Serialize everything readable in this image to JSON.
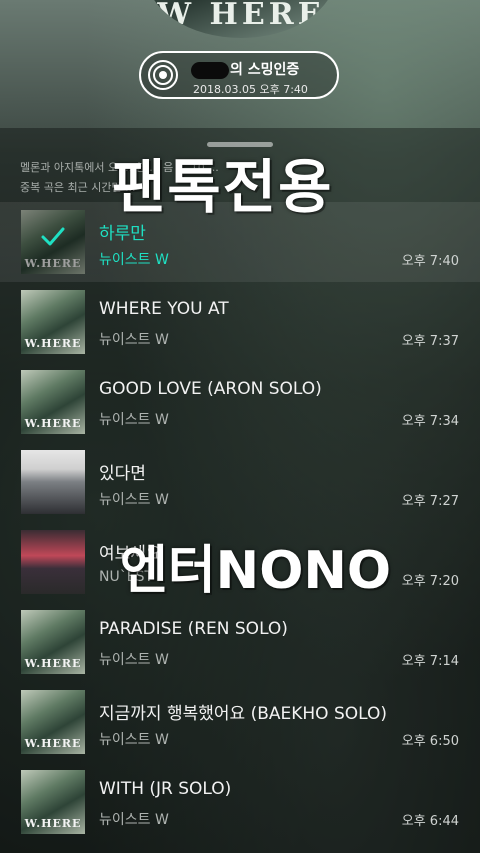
{
  "header": {
    "album_text": "W HERE",
    "cert_title_suffix": "의 스밍인증",
    "cert_date": "2018.03.05 오후 7:40"
  },
  "notice": {
    "line1": "멜론과 아지톡에서 오 ... 한 ... 음 ... 10 ...",
    "line2": "중복 곡은 최근 시간만 ..."
  },
  "watermarks": {
    "top": "팬톡전용",
    "middle": "엔터NONO"
  },
  "tracks": [
    {
      "title": "하루만",
      "artist": "뉴이스트 W",
      "time": "오후 7:40",
      "active": true,
      "cover": "W.HERE"
    },
    {
      "title": "WHERE YOU AT",
      "artist": "뉴이스트 W",
      "time": "오후 7:37",
      "active": false,
      "cover": "W.HERE"
    },
    {
      "title": "GOOD LOVE (ARON SOLO)",
      "artist": "뉴이스트 W",
      "time": "오후 7:34",
      "active": false,
      "cover": "W.HERE"
    },
    {
      "title": "있다면",
      "artist": "뉴이스트 W",
      "time": "오후 7:27",
      "active": false,
      "cover": ""
    },
    {
      "title": "여보세요",
      "artist": "NU`EST",
      "time": "오후 7:20",
      "active": false,
      "cover": ""
    },
    {
      "title": "PARADISE (REN SOLO)",
      "artist": "뉴이스트 W",
      "time": "오후 7:14",
      "active": false,
      "cover": "W.HERE"
    },
    {
      "title": "지금까지 행복했어요 (BAEKHO SOLO)",
      "artist": "뉴이스트 W",
      "time": "오후 6:50",
      "active": false,
      "cover": "W.HERE"
    },
    {
      "title": "WITH (JR SOLO)",
      "artist": "뉴이스트 W",
      "time": "오후 6:44",
      "active": false,
      "cover": "W.HERE"
    }
  ],
  "colors": {
    "accent": "#1fe0c3",
    "text": "#f2f2f2",
    "subtext": "#aeb3b0"
  },
  "icons": {
    "cert": "disc-icon",
    "playing": "check-icon"
  }
}
